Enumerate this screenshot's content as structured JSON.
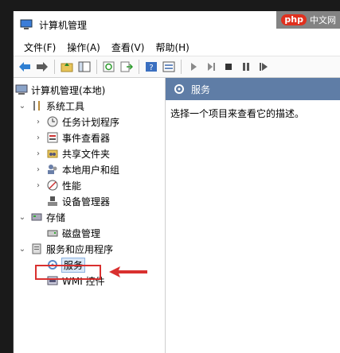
{
  "window": {
    "title": "计算机管理"
  },
  "watermark": {
    "logo": "php",
    "text": "中文网"
  },
  "menu": [
    "文件(F)",
    "操作(A)",
    "查看(V)",
    "帮助(H)"
  ],
  "toolbar": {
    "icons": [
      "back-arrow-icon",
      "forward-arrow-icon",
      "folder-up-icon",
      "console-tree-icon",
      "refresh-icon",
      "export-icon",
      "help-icon",
      "properties-icon",
      "play-icon",
      "play-next-icon",
      "stop-icon",
      "pause-icon",
      "restart-icon"
    ]
  },
  "tree": {
    "root": "计算机管理(本地)",
    "items": [
      "系统工具",
      "任务计划程序",
      "事件查看器",
      "共享文件夹",
      "本地用户和组",
      "性能",
      "设备管理器",
      "存储",
      "磁盘管理",
      "服务和应用程序",
      "服务",
      "WMI 控件"
    ]
  },
  "detail": {
    "header": "服务",
    "description": "选择一个项目来查看它的描述。"
  },
  "colors": {
    "header_bg": "#5f7da6",
    "highlight": "#d9302f"
  }
}
